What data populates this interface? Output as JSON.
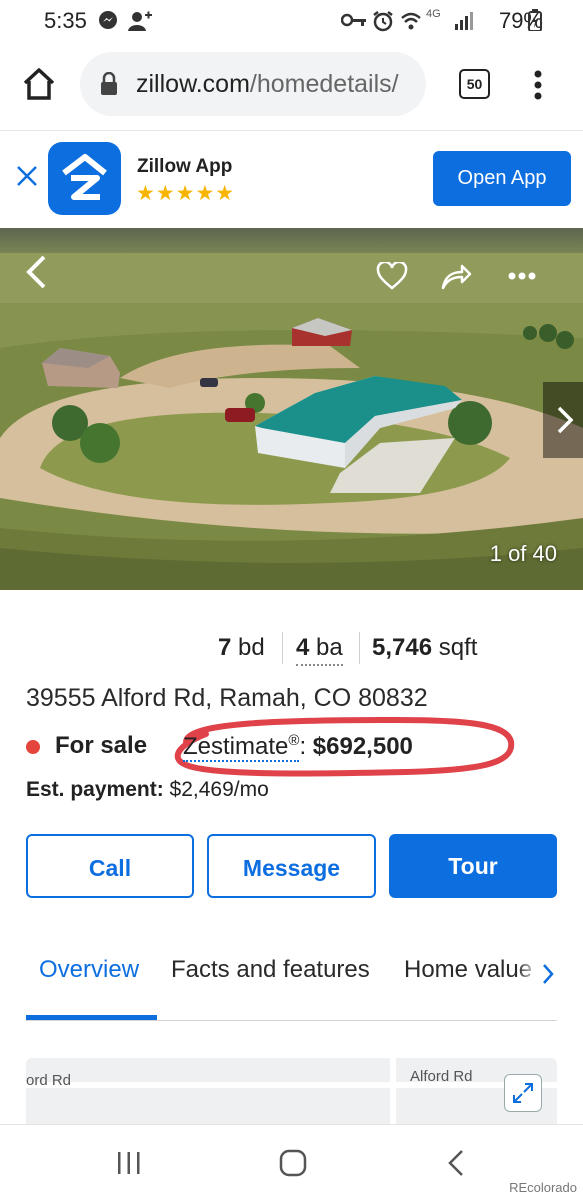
{
  "status_bar": {
    "time": "5:35",
    "battery": "79%"
  },
  "browser": {
    "url_host": "zillow.com",
    "url_path": "/homedetails/",
    "tab_count": "50"
  },
  "app_banner": {
    "title": "Zillow App",
    "rating_stars": 5,
    "stars_text": "★★★★★",
    "open_label": "Open App"
  },
  "gallery": {
    "counter": "1 of 40"
  },
  "facts": {
    "beds_value": "7",
    "beds_unit": "bd",
    "baths_value": "4",
    "baths_unit": "ba",
    "sqft_value": "5,746",
    "sqft_unit": "sqft"
  },
  "address": "39555 Alford Rd, Ramah, CO 80832",
  "status": {
    "label": "For sale",
    "color": "#e4453c"
  },
  "zestimate": {
    "label": "Zestimate",
    "reg": "®",
    "colon": ": ",
    "value": "$692,500"
  },
  "payment": {
    "label": "Est. payment:",
    "value": "$2,469/mo"
  },
  "actions": {
    "call": "Call",
    "message": "Message",
    "tour": "Tour"
  },
  "tabs": [
    {
      "label": "Overview",
      "active": true
    },
    {
      "label": "Facts and features",
      "active": false
    },
    {
      "label": "Home value",
      "active": false
    }
  ],
  "map": {
    "road_label_left": "ord Rd",
    "road_label_right": "Alford Rd"
  },
  "watermark": "REcolorado",
  "colors": {
    "accent": "#0d6ee0",
    "annotation": "#e0424a"
  }
}
